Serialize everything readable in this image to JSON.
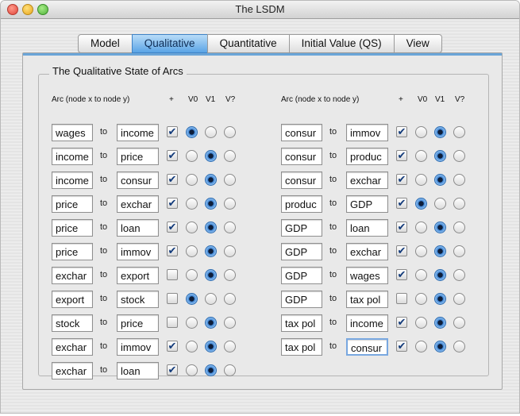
{
  "window": {
    "title": "The LSDM"
  },
  "tabs": [
    {
      "label": "Model",
      "active": false
    },
    {
      "label": "Qualitative",
      "active": true
    },
    {
      "label": "Quantitative",
      "active": false
    },
    {
      "label": "Initial Value (QS)",
      "active": false
    },
    {
      "label": "View",
      "active": false
    }
  ],
  "group": {
    "title": "The Qualitative State of Arcs"
  },
  "columns": {
    "arc": "Arc (node x to node y)",
    "plus": "+",
    "v0": "V0",
    "v1": "V1",
    "vq": "V?",
    "to": "to"
  },
  "arcs_left": [
    {
      "x": "wages",
      "y": "income",
      "plus": true,
      "sel": "V0"
    },
    {
      "x": "income",
      "y": "price",
      "plus": true,
      "sel": "V1"
    },
    {
      "x": "income",
      "y": "consur",
      "plus": true,
      "sel": "V1"
    },
    {
      "x": "price",
      "y": "exchar",
      "plus": true,
      "sel": "V1"
    },
    {
      "x": "price",
      "y": "loan",
      "plus": true,
      "sel": "V1"
    },
    {
      "x": "price",
      "y": "immov",
      "plus": true,
      "sel": "V1"
    },
    {
      "x": "exchar",
      "y": "export",
      "plus": false,
      "sel": "V1"
    },
    {
      "x": "export",
      "y": "stock",
      "plus": false,
      "sel": "V0"
    },
    {
      "x": "stock",
      "y": "price",
      "plus": false,
      "sel": "V1"
    },
    {
      "x": "exchar",
      "y": "immov",
      "plus": true,
      "sel": "V1"
    },
    {
      "x": "exchar",
      "y": "loan",
      "plus": true,
      "sel": "V1"
    }
  ],
  "arcs_right": [
    {
      "x": "consur",
      "y": "immov",
      "plus": true,
      "sel": "V1"
    },
    {
      "x": "consur",
      "y": "produc",
      "plus": true,
      "sel": "V1"
    },
    {
      "x": "consur",
      "y": "exchar",
      "plus": true,
      "sel": "V1"
    },
    {
      "x": "produc",
      "y": "GDP",
      "plus": true,
      "sel": "V0"
    },
    {
      "x": "GDP",
      "y": "loan",
      "plus": true,
      "sel": "V1"
    },
    {
      "x": "GDP",
      "y": "exchar",
      "plus": true,
      "sel": "V1"
    },
    {
      "x": "GDP",
      "y": "wages",
      "plus": true,
      "sel": "V1"
    },
    {
      "x": "GDP",
      "y": "tax pol",
      "plus": false,
      "sel": "V1"
    },
    {
      "x": "tax pol",
      "y": "income",
      "plus": true,
      "sel": "V1"
    },
    {
      "x": "tax pol",
      "y": "consur",
      "plus": true,
      "sel": "V1",
      "focused": true
    }
  ],
  "colors": {
    "accent": "#5aa4e6",
    "checkmark": "#123a7a"
  }
}
